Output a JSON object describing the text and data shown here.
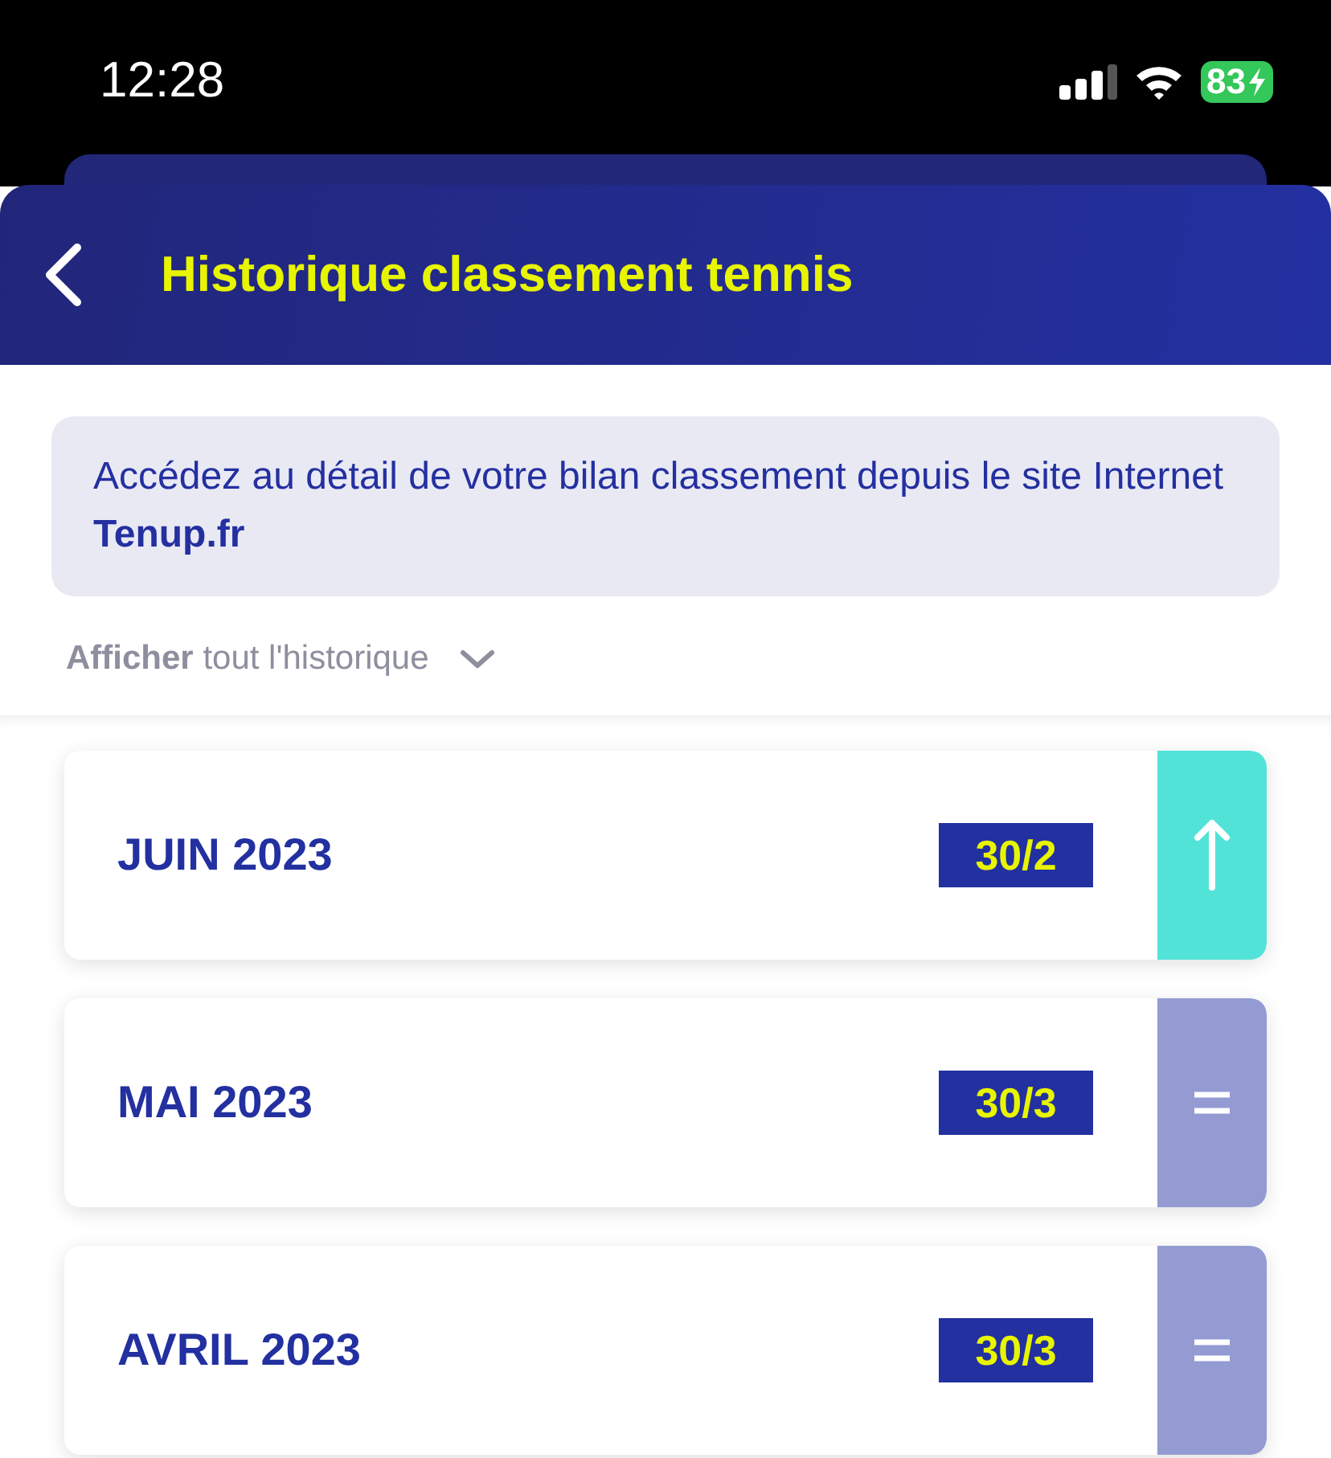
{
  "status_bar": {
    "time": "12:28",
    "battery": "83"
  },
  "header": {
    "title": "Historique classement tennis"
  },
  "info": {
    "text": "Accédez au détail de votre bilan classement depuis le site Internet **Tenup.fr**"
  },
  "history_toggle": {
    "label": "**Afficher** tout l'historique",
    "expanded": false
  },
  "rankings": [
    {
      "month": "JUIN 2023",
      "rank": "30/2",
      "kind": "up"
    },
    {
      "month": "MAI 2023",
      "rank": "30/3",
      "kind": "equal"
    },
    {
      "month": "AVRIL 2023",
      "rank": "30/3",
      "kind": "equal"
    }
  ]
}
